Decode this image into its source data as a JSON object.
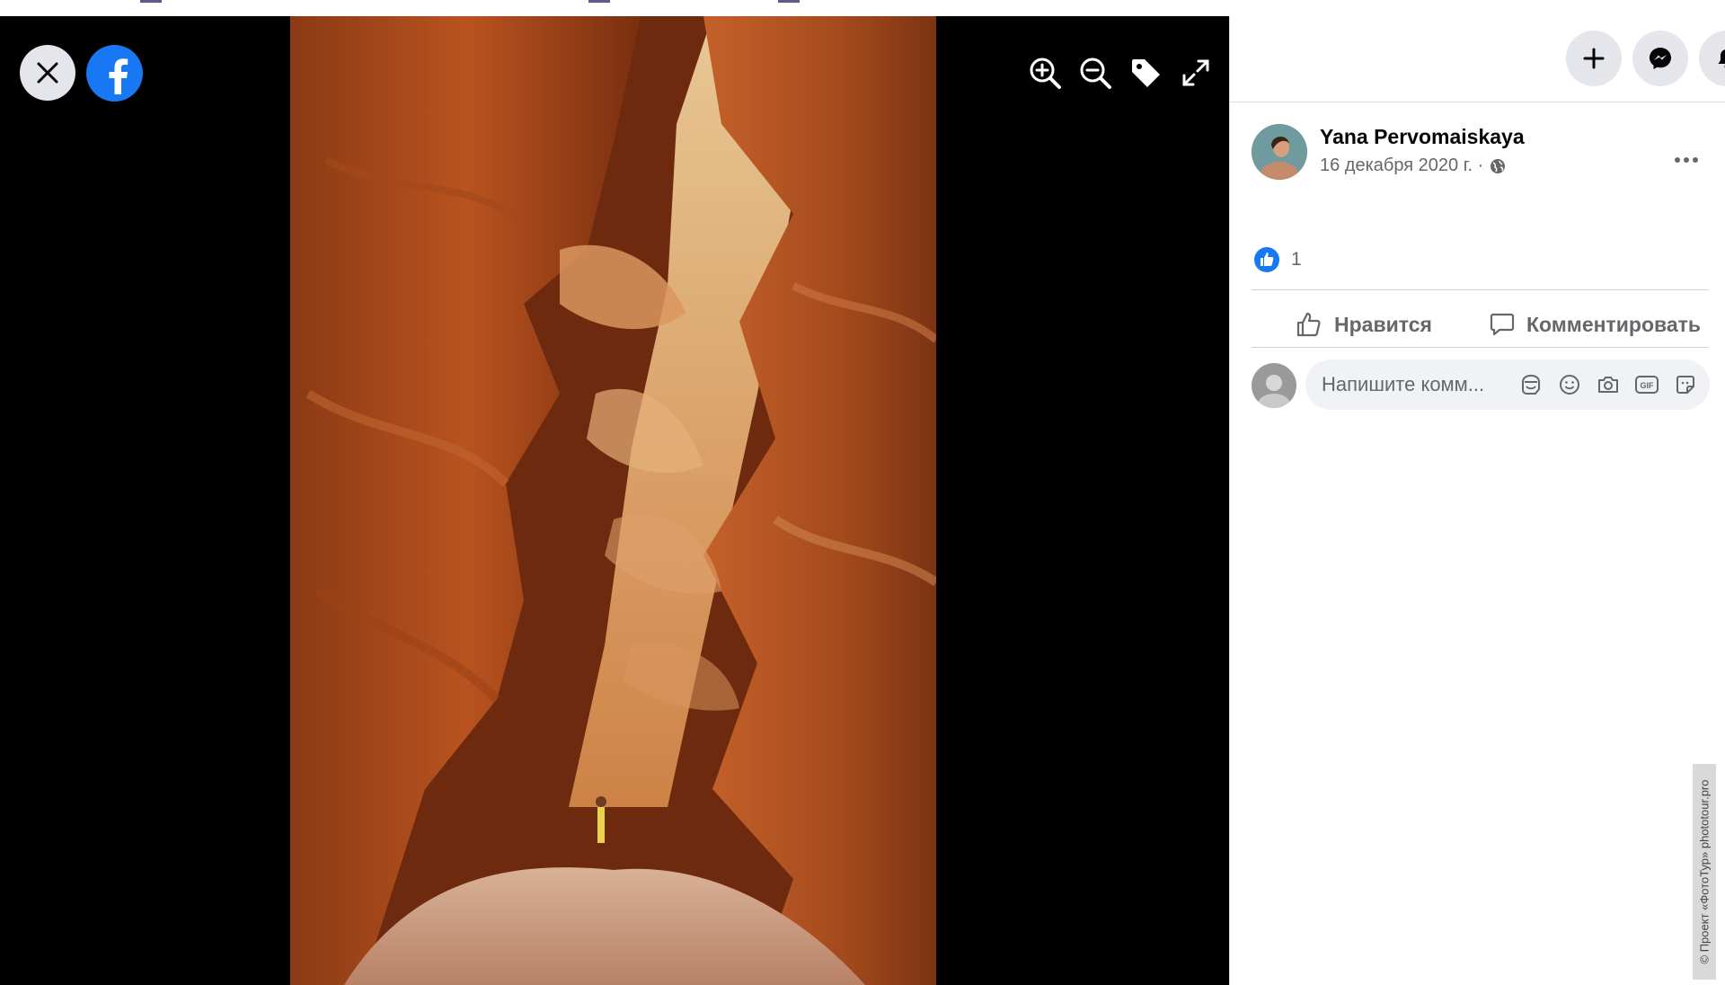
{
  "viewer": {
    "photo_subject": "Slot canyon photo",
    "controls": {
      "close_icon": "close-icon",
      "brand_icon": "facebook-logo-icon",
      "zoom_in_icon": "zoom-in-icon",
      "zoom_out_icon": "zoom-out-icon",
      "tag_icon": "tag-icon",
      "fullscreen_icon": "fullscreen-icon"
    }
  },
  "header": {
    "buttons": [
      {
        "icon": "plus-icon"
      },
      {
        "icon": "messenger-icon"
      },
      {
        "icon": "bell-icon"
      }
    ]
  },
  "post": {
    "author": "Yana Pervomaiskaya",
    "date": "16 декабря 2020 г. ·",
    "privacy_icon": "globe-icon",
    "more_icon": "more-dots-icon"
  },
  "reactions": {
    "like_count": "1",
    "like_icon": "like-reaction-icon"
  },
  "actions": {
    "like_label": "Нравится",
    "comment_label": "Комментировать"
  },
  "comment": {
    "placeholder": "Напишите комм...",
    "tools": [
      "avatar-sticker-icon",
      "emoji-icon",
      "camera-icon",
      "gif-icon",
      "sticker-icon"
    ]
  },
  "watermark": {
    "text": "© Проект «ФотоТур» phototour.pro"
  },
  "colors": {
    "brand": "#1877f2",
    "viewer_bg": "#000000",
    "button_gray": "#e4e6eb",
    "secondary_text": "#65676b"
  }
}
